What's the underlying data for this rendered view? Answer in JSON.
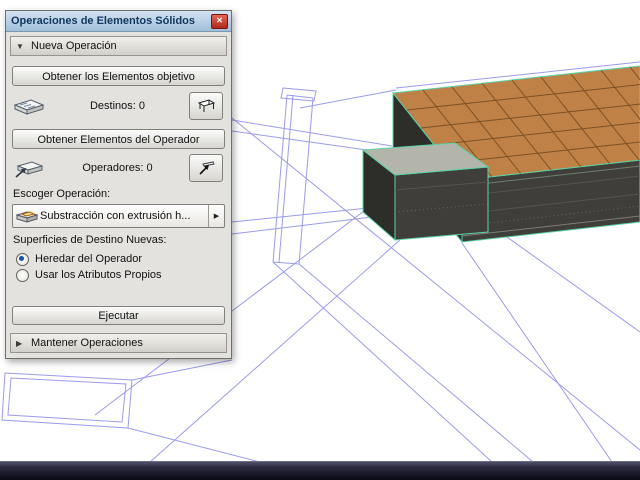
{
  "dialog": {
    "title": "Operaciones de Elementos Sólidos",
    "sections": {
      "new_operation": {
        "label": "Nueva Operación",
        "collapsed": false
      },
      "keep_operations": {
        "label": "Mantener Operaciones",
        "collapsed": true
      }
    },
    "buttons": {
      "get_targets": "Obtener los Elementos objetivo",
      "get_operators": "Obtener Elementos del Operador",
      "execute": "Ejecutar"
    },
    "counters": {
      "targets": "Destinos: 0",
      "operators": "Operadores: 0"
    },
    "labels": {
      "choose_operation": "Escoger Operación:",
      "new_target_surfaces": "Superficies de Destino Nuevas:"
    },
    "operation_dropdown": {
      "value": "Substracción con extrusión h..."
    },
    "radios": [
      {
        "label": "Heredar del Operador",
        "selected": true
      },
      {
        "label": "Usar los Atributos Propios",
        "selected": false
      }
    ]
  },
  "icons": {
    "close": "✕",
    "triangle_down": "▼",
    "triangle_right": "▶",
    "menu_arrow": "▶"
  },
  "scene": {
    "colors": {
      "wireframe": "#9b9bec",
      "tile": "#bf8146",
      "tile_grid": "#7c5024",
      "concrete_front": "#3f3e3a",
      "concrete_side": "#2d2d2a",
      "step_top": "#b4b5aa",
      "edge_highlight": "#5bd2a6"
    }
  }
}
